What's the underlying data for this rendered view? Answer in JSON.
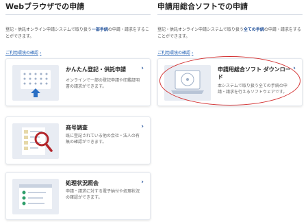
{
  "left": {
    "title": "Webブラウザでの申請",
    "desc_prefix": "登記・供託オンライン申請システムで取り扱う",
    "desc_bold": "一部手続",
    "desc_suffix": "の申請・請求をすることができます。",
    "env_link": "ご利用環境の確認",
    "cards": [
      {
        "title": "かんたん登記・供託申請",
        "desc": "オンラインで一部の登記申請や印鑑証明書の請求ができます。"
      },
      {
        "title": "商号調査",
        "desc": "既に登記されている他の会社・法人の有無の確認ができます。"
      },
      {
        "title": "処理状況照会",
        "desc": "申請・請求に対する電子納付や処理状況の確認ができます。"
      }
    ]
  },
  "right": {
    "title": "申請用総合ソフトでの申請",
    "desc_prefix": "登記・供託オンライン申請システムで取り扱う",
    "desc_bold": "全ての手続",
    "desc_suffix": "の申請・請求をすることができます。",
    "env_link": "ご利用環境の確認",
    "card": {
      "title": "申請用総合ソフト ダウンロード",
      "desc": "本システムで取り扱う全ての手続の申請・請求を行えるソフトウェアです。"
    }
  },
  "arrow_glyph": "›",
  "colors": {
    "accent": "#1f4f99",
    "highlight_oval": "#d32f2f",
    "magnifier": "#b3262b",
    "upload_arrow": "#2a6fc4",
    "check": "#2e9e6a"
  }
}
